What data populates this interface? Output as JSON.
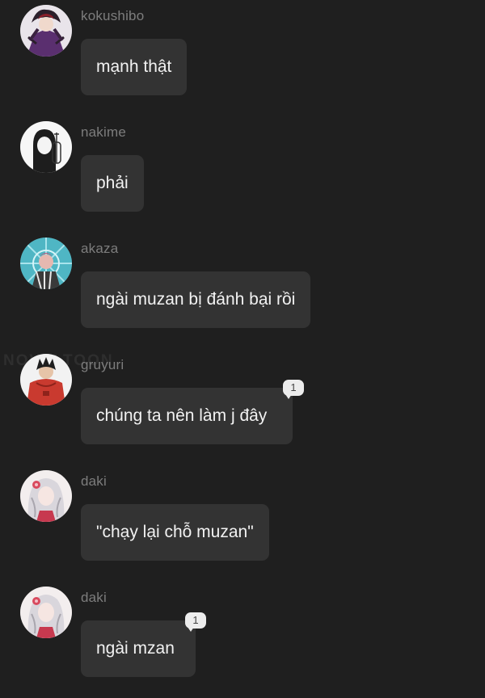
{
  "messages": [
    {
      "username": "kokushibo",
      "text": "mạnh thật",
      "avatar": "kokushibo-avatar",
      "reaction_count": ""
    },
    {
      "username": "nakime",
      "text": "phải",
      "avatar": "nakime-avatar",
      "reaction_count": ""
    },
    {
      "username": "akaza",
      "text": "ngài muzan bị đánh bại rồi",
      "avatar": "akaza-avatar",
      "reaction_count": ""
    },
    {
      "username": "gruyuri",
      "text": "chúng ta nên làm j đây",
      "avatar": "gruyuri-avatar",
      "reaction_count": "1"
    },
    {
      "username": "daki",
      "text": "\"chạy lại chỗ muzan\"",
      "avatar": "daki-avatar",
      "reaction_count": ""
    },
    {
      "username": "daki",
      "text": "ngài mzan",
      "avatar": "daki-avatar",
      "reaction_count": "1"
    }
  ],
  "watermark": "NOVELTOON",
  "colors": {
    "background": "#1f1f1f",
    "bubble": "#333333",
    "username": "#7d7d7d",
    "message_text": "#f2f2f2",
    "badge": "#ececec"
  }
}
